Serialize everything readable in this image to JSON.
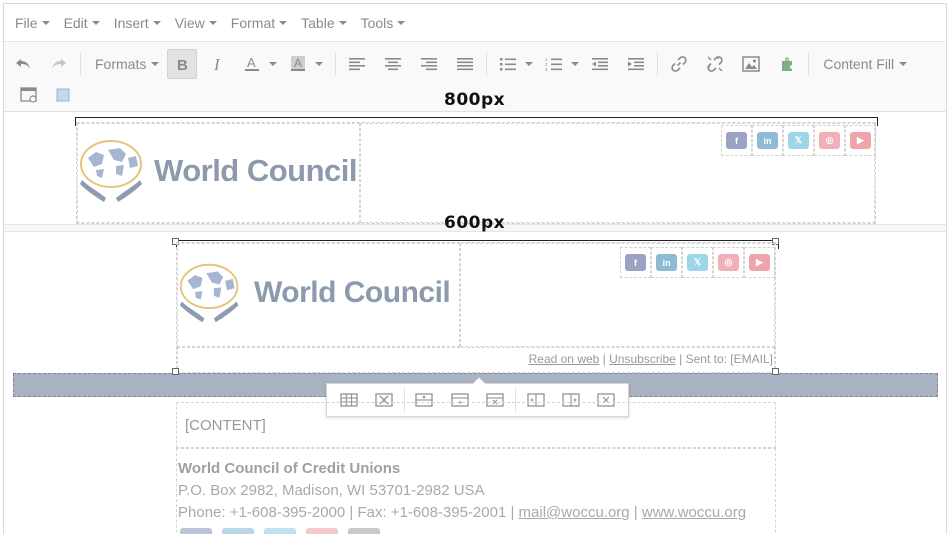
{
  "menubar": {
    "items": [
      {
        "label": "File"
      },
      {
        "label": "Edit"
      },
      {
        "label": "Insert"
      },
      {
        "label": "View"
      },
      {
        "label": "Format"
      },
      {
        "label": "Table"
      },
      {
        "label": "Tools"
      }
    ]
  },
  "toolbar": {
    "formats_label": "Formats",
    "content_fill_label": "Content Fill",
    "bold_active": true
  },
  "canvas": {
    "ruler_800_label": "800px",
    "ruler_600_label": "600px"
  },
  "email": {
    "logo_text": "World Council",
    "social": [
      {
        "icon": "facebook-icon",
        "glyph": "f",
        "color": "#9aa3c4"
      },
      {
        "icon": "linkedin-icon",
        "glyph": "in",
        "color": "#8fbad6"
      },
      {
        "icon": "x-icon",
        "glyph": "𝕏",
        "color": "#9dd6e8"
      },
      {
        "icon": "instagram-icon",
        "glyph": "◎",
        "color": "#efb0b8"
      },
      {
        "icon": "youtube-icon",
        "glyph": "▶",
        "color": "#eea5a9"
      }
    ],
    "read_on_web": "Read on web",
    "separator": " | ",
    "unsubscribe": "Unsubscribe",
    "sent_to": " | Sent to: [EMAIL]",
    "content_placeholder": "[CONTENT]",
    "footer": {
      "org": "World Council of Credit Unions",
      "address": "P.O. Box 2982, Madison, WI 53701-2982 USA",
      "contact_prefix": "Phone: +1-608-395-2000 | Fax: +1-608-395-2001 | ",
      "email": "mail@woccu.org",
      "divider": " | ",
      "website": "www.woccu.org"
    }
  },
  "colors": {
    "band": "#a9b2c3",
    "logo_text": "#8d9aae",
    "globe": "#a7b6d0",
    "globe_ring": "#e8c27a",
    "hands": "#8f9bb0"
  }
}
